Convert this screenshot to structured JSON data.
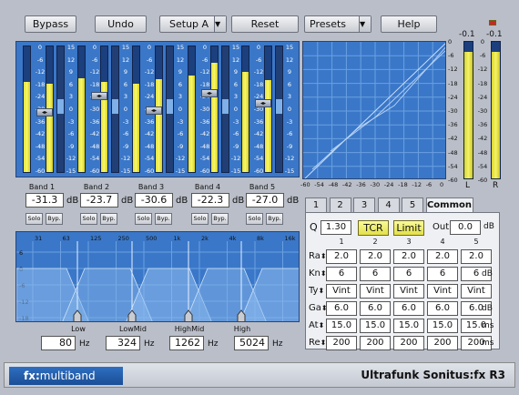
{
  "toolbar": {
    "bypass": "Bypass",
    "undo": "Undo",
    "setup": "Setup A",
    "reset": "Reset",
    "presets": "Presets",
    "help": "Help"
  },
  "meter_scale": [
    "0",
    "-6",
    "-12",
    "-18",
    "-24",
    "-30",
    "-36",
    "-42",
    "-48",
    "-54",
    "-60"
  ],
  "gr_scale": [
    "15",
    "12",
    "9",
    "6",
    "3",
    "0",
    "-3",
    "-6",
    "-9",
    "-12",
    "-15"
  ],
  "bands": [
    {
      "label": "Band 1",
      "value": "-31.3",
      "in_level": 0.72,
      "out_level": 0.7
    },
    {
      "label": "Band 2",
      "value": "-23.7",
      "in_level": 0.75,
      "out_level": 0.72
    },
    {
      "label": "Band 3",
      "value": "-30.6",
      "in_level": 0.7,
      "out_level": 0.74
    },
    {
      "label": "Band 4",
      "value": "-22.3",
      "in_level": 0.77,
      "out_level": 0.87
    },
    {
      "label": "Band 5",
      "value": "-27.0",
      "in_level": 0.8,
      "out_level": 0.73
    }
  ],
  "db_unit": "dB",
  "solo": "Solo",
  "byp": "Byp.",
  "graph_x": [
    "-60",
    "-54",
    "-48",
    "-42",
    "-36",
    "-30",
    "-24",
    "-18",
    "-12",
    "-6",
    "0"
  ],
  "graph_y": [
    "0",
    "-6",
    "-12",
    "-18",
    "-24",
    "-30",
    "-36",
    "-42",
    "-48",
    "-54",
    "-60"
  ],
  "out_meters": {
    "left_peak": "-0.1",
    "right_peak": "-0.1",
    "left_label": "L",
    "right_label": "R",
    "left_level": 0.93,
    "right_level": 0.93
  },
  "tabs": [
    "1",
    "2",
    "3",
    "4",
    "5",
    "Common"
  ],
  "common": {
    "q_label": "Q",
    "q_value": "1.30",
    "tcr": "TCR",
    "limit": "Limit",
    "out_label": "Out",
    "out_value": "0.0",
    "out_unit": "dB",
    "cols": [
      "1",
      "2",
      "3",
      "4",
      "5"
    ],
    "rows": [
      {
        "label": "Ra",
        "values": [
          "2.0",
          "2.0",
          "2.0",
          "2.0",
          "2.0"
        ],
        "unit": ""
      },
      {
        "label": "Kn",
        "values": [
          "6",
          "6",
          "6",
          "6",
          "6"
        ],
        "unit": "dB"
      },
      {
        "label": "Ty",
        "values": [
          "Vint",
          "Vint",
          "Vint",
          "Vint",
          "Vint"
        ],
        "unit": ""
      },
      {
        "label": "Ga",
        "values": [
          "6.0",
          "6.0",
          "6.0",
          "6.0",
          "6.0"
        ],
        "unit": "dB"
      },
      {
        "label": "At",
        "values": [
          "15.0",
          "15.0",
          "15.0",
          "15.0",
          "15.0"
        ],
        "unit": "ms"
      },
      {
        "label": "Re",
        "values": [
          "200",
          "200",
          "200",
          "200",
          "200"
        ],
        "unit": "ms"
      }
    ]
  },
  "freq_ticks": [
    "31",
    "63",
    "125",
    "250",
    "500",
    "1k",
    "2k",
    "4k",
    "8k",
    "16k"
  ],
  "freq_db": [
    "6",
    "0",
    "-6",
    "-12",
    "-18"
  ],
  "crossovers": [
    {
      "label": "Low",
      "value": "80",
      "unit": "Hz"
    },
    {
      "label": "LowMid",
      "value": "324",
      "unit": "Hz"
    },
    {
      "label": "HighMid",
      "value": "1262",
      "unit": "Hz"
    },
    {
      "label": "High",
      "value": "5024",
      "unit": "Hz"
    }
  ],
  "footer": {
    "brand_prefix": "fx:",
    "brand_name": "multiband",
    "product": "Ultrafunk Sonitus:fx R3"
  }
}
